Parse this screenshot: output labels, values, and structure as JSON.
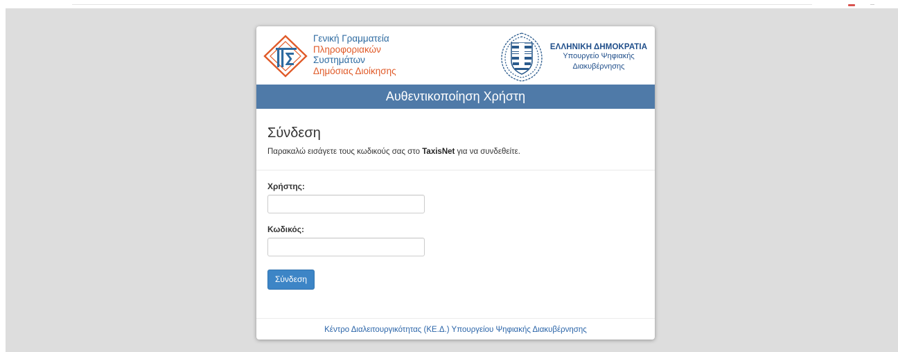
{
  "header": {
    "gsis_logo_lines": [
      "Γενική Γραμματεία",
      "Πληροφοριακών",
      "Συστημάτων",
      "Δημόσιας Διοίκησης"
    ],
    "gov_title": "ΕΛΛΗΝΙΚΗ ΔΗΜΟΚΡΑΤΙΑ",
    "gov_subtitle_line1": "Υπουργείο Ψηφιακής",
    "gov_subtitle_line2": "Διακυβέρνησης"
  },
  "title_bar": "Αυθεντικοποίηση Χρήστη",
  "form": {
    "heading": "Σύνδεση",
    "intro_before": "Παρακαλώ εισάγετε τους κωδικούς σας στο ",
    "intro_bold": "TaxisNet",
    "intro_after": " για να συνδεθείτε.",
    "username_label": "Χρήστης:",
    "username_value": "",
    "password_label": "Κωδικός:",
    "password_value": "",
    "submit_label": "Σύνδεση"
  },
  "footer": {
    "link_text": "Κέντρο Διαλειτουργικότητας (ΚΕ.Δ.) Υπουργείου Ψηφιακής Διακυβέρνησης"
  },
  "colors": {
    "title_bar": "#4f7aa8",
    "button": "#3d85c6",
    "link": "#2a64a8",
    "gsis_blue": "#2d6aa0",
    "gsis_orange": "#e05a28",
    "background": "#dddddd"
  },
  "icons": [
    "gsis-logo-icon",
    "greek-emblem-icon"
  ]
}
